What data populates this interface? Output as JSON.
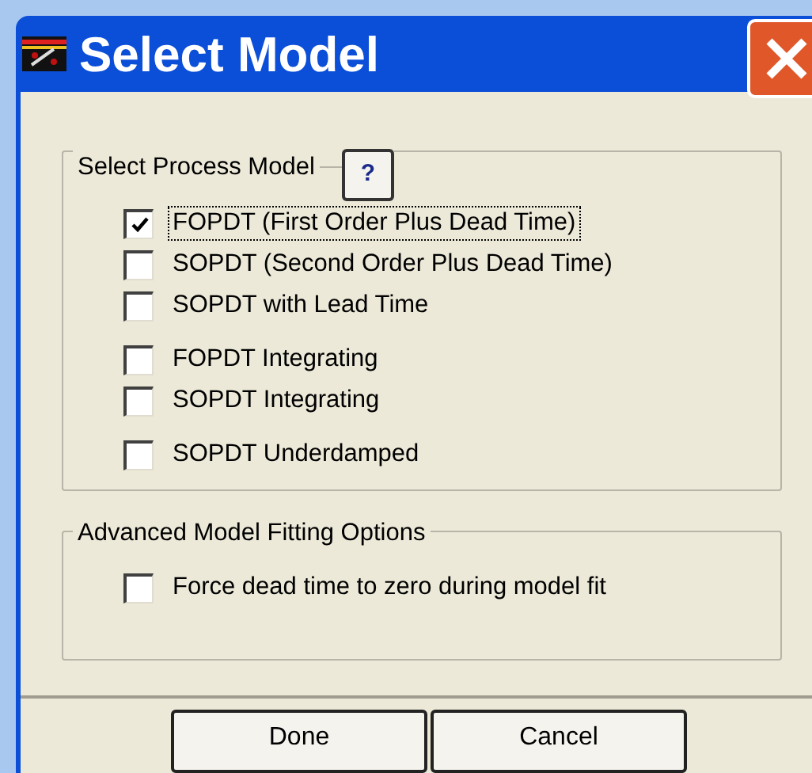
{
  "window": {
    "title": "Select Model"
  },
  "process_model": {
    "title": "Select Process Model",
    "help": "?",
    "options": [
      {
        "label": "FOPDT (First Order Plus Dead Time)",
        "checked": true,
        "focused": true
      },
      {
        "label": "SOPDT (Second Order Plus Dead Time)",
        "checked": false,
        "focused": false
      },
      {
        "label": "SOPDT with Lead Time",
        "checked": false,
        "focused": false
      },
      {
        "label": "FOPDT Integrating",
        "checked": false,
        "focused": false
      },
      {
        "label": "SOPDT Integrating",
        "checked": false,
        "focused": false
      },
      {
        "label": "SOPDT Underdamped",
        "checked": false,
        "focused": false
      }
    ]
  },
  "advanced": {
    "title": "Advanced Model Fitting Options",
    "options": [
      {
        "label": "Force dead time to zero during model fit",
        "checked": false,
        "focused": false
      }
    ]
  },
  "buttons": [
    "Done",
    "Cancel"
  ]
}
